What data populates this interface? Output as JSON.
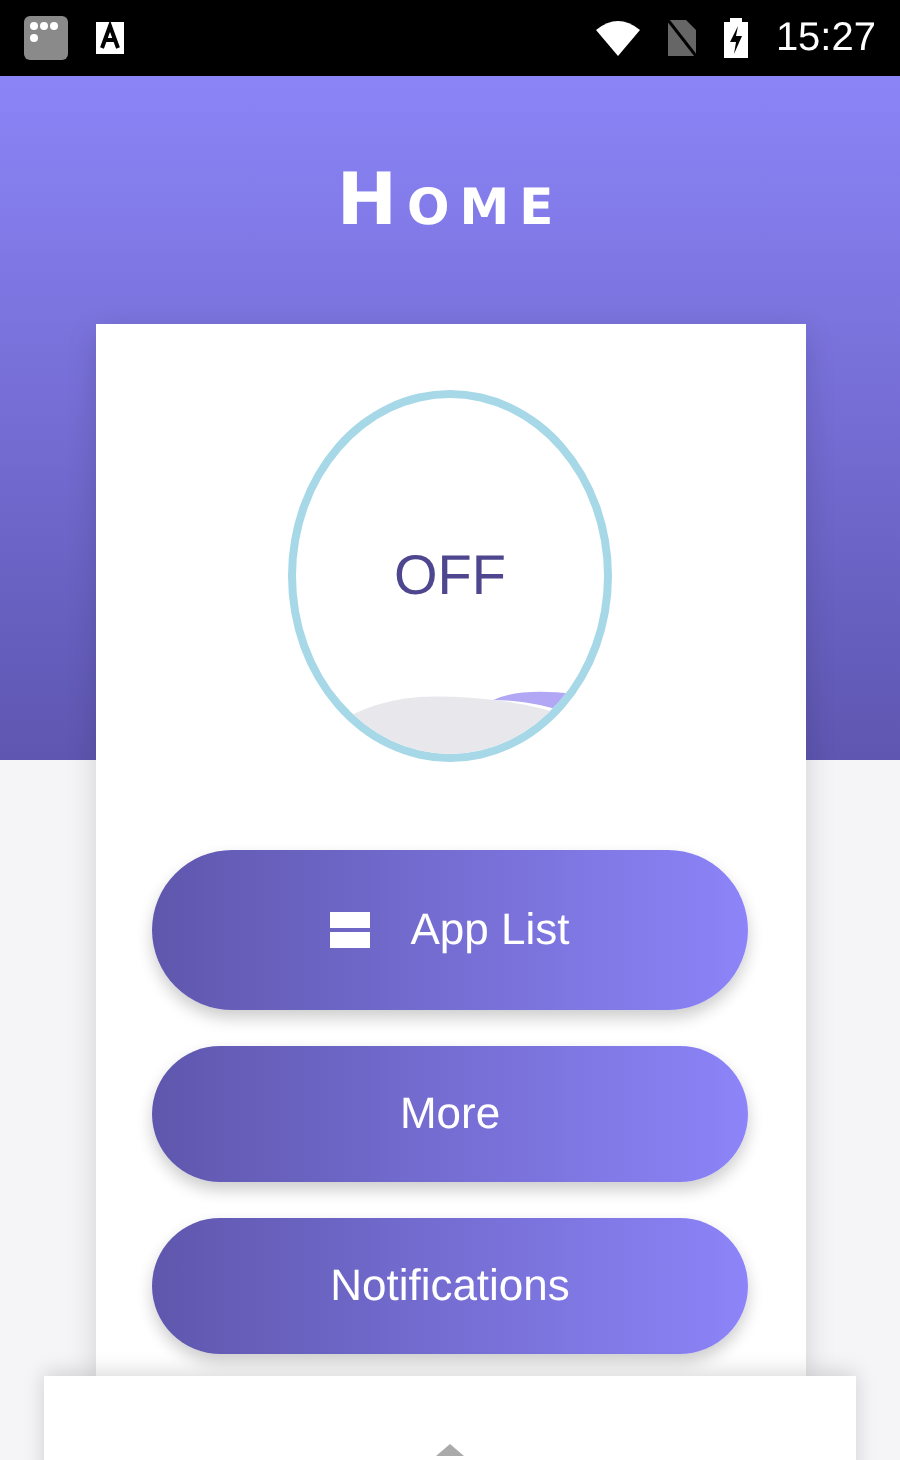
{
  "status_bar": {
    "time": "15:27"
  },
  "header": {
    "title": "Home"
  },
  "power": {
    "label": "OFF",
    "on": false
  },
  "buttons": [
    {
      "label": "App List",
      "kind": "icon"
    },
    {
      "label": "More",
      "kind": "plain"
    },
    {
      "label": "Notifications",
      "kind": "plain"
    }
  ]
}
